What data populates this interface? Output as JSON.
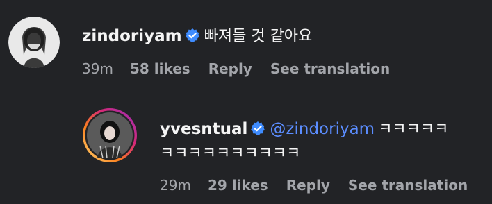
{
  "comments": [
    {
      "username": "zindoriyam",
      "verified": true,
      "text": "빠져들 것 같아요",
      "time": "39m",
      "likes": "58 likes",
      "reply": "Reply",
      "translate": "See translation"
    },
    {
      "username": "yvesntual",
      "verified": true,
      "mention": "@zindoriyam",
      "text_line1": "ㅋㅋㅋㅋㅋ",
      "text_line2": "ㅋㅋㅋㅋㅋㅋㅋㅋㅋㅋ",
      "time": "29m",
      "likes": "29 likes",
      "reply": "Reply",
      "translate": "See translation"
    }
  ],
  "colors": {
    "background": "#222326",
    "text_primary": "#f5f5f5",
    "text_secondary": "#a3a5aa",
    "mention": "#5b8dff",
    "verified_badge": "#3f8cff"
  },
  "icons": {
    "verified": "verified-badge-icon"
  }
}
